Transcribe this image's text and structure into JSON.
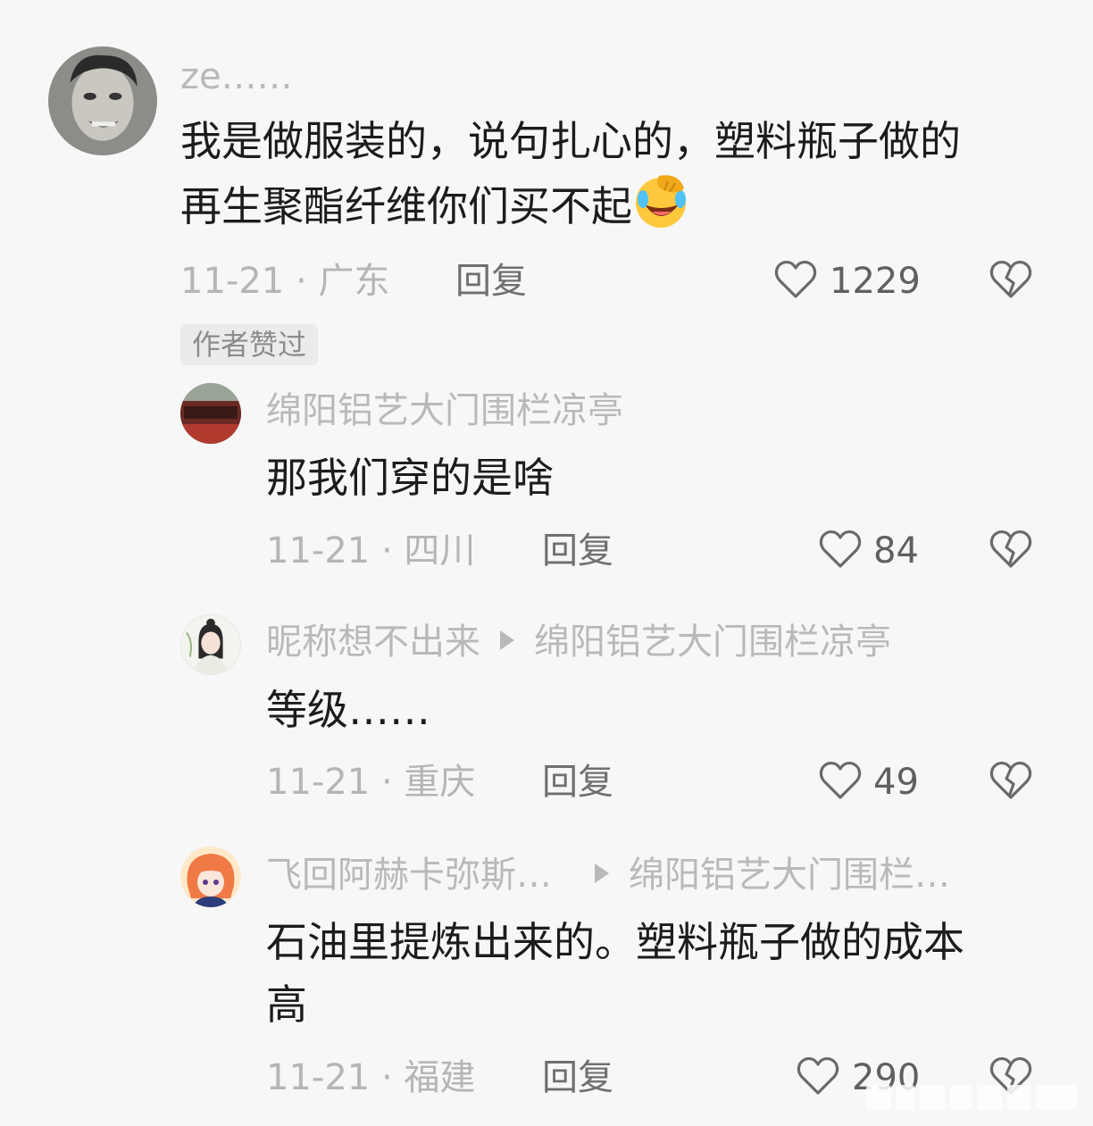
{
  "comments": [
    {
      "username": "ze……",
      "content_line1": "我是做服装的，说句扎心的，塑料瓶子做的",
      "content_line2": "再生聚酯纤维你们买不起",
      "emoji": "facepalm-laughing-emoji",
      "meta": "11-21 · 广东",
      "reply_label": "回复",
      "likes": "1229",
      "badge": "作者赞过"
    },
    {
      "username": "绵阳铝艺大门围栏凉亭",
      "content": "那我们穿的是啥",
      "meta": "11-21 · 四川",
      "reply_label": "回复",
      "likes": "84"
    },
    {
      "username": "昵称想不出来",
      "reply_to": "绵阳铝艺大门围栏凉亭",
      "content": "等级……",
      "meta": "11-21 · 重庆",
      "reply_label": "回复",
      "likes": "49"
    },
    {
      "username": "飞回阿赫卡弥斯…",
      "reply_to": "绵阳铝艺大门围栏…",
      "content_line1": "石油里提炼出来的。塑料瓶子做的成本",
      "content_line2": "高",
      "meta": "11-21 · 福建",
      "reply_label": "回复",
      "likes": "290"
    }
  ],
  "icons": {
    "like": "heart-outline-icon",
    "dislike": "broken-heart-icon"
  },
  "colors": {
    "background": "#f7f7f7",
    "username": "#b9b9b9",
    "content": "#1c1c1c",
    "meta": "#b5b5b5",
    "reply": "#6f6f6f"
  }
}
